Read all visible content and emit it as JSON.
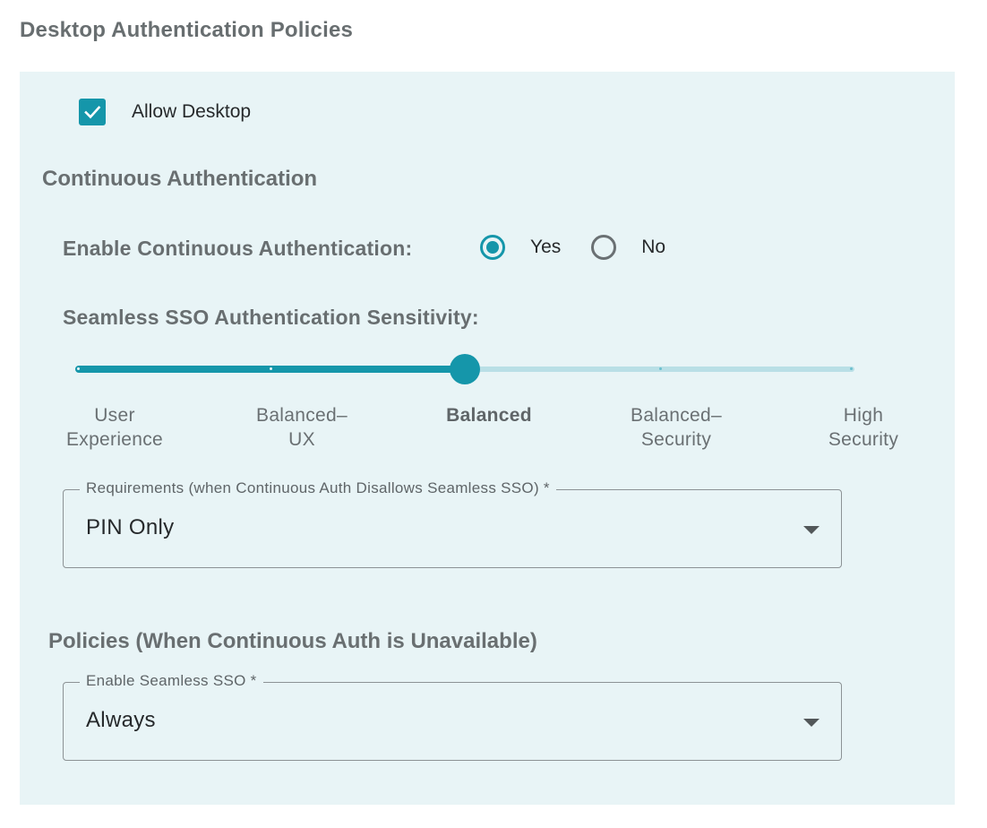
{
  "page": {
    "title": "Desktop Authentication Policies"
  },
  "allow_desktop": {
    "label": "Allow Desktop",
    "checked": true
  },
  "continuous_auth": {
    "section_title": "Continuous Authentication",
    "enable_label": "Enable Continuous Authentication:",
    "options": [
      {
        "label": "Yes",
        "selected": true
      },
      {
        "label": "No",
        "selected": false
      }
    ],
    "sensitivity": {
      "label": "Seamless SSO Authentication Sensitivity:",
      "marks": [
        {
          "line1": "User",
          "line2": "Experience"
        },
        {
          "line1": "Balanced–",
          "line2": "UX"
        },
        {
          "line1": "Balanced",
          "line2": ""
        },
        {
          "line1": "Balanced–",
          "line2": "Security"
        },
        {
          "line1": "High",
          "line2": "Security"
        }
      ],
      "selected_index": 2
    },
    "requirements": {
      "legend": "Requirements (when Continuous Auth Disallows Seamless SSO) *",
      "value": "PIN Only"
    }
  },
  "fallback_policies": {
    "section_title": "Policies (When Continuous Auth is Unavailable)",
    "seamless_sso": {
      "legend": "Enable Seamless SSO *",
      "value": "Always"
    }
  },
  "colors": {
    "accent": "#1596aa",
    "panel_background": "#e8f4f6",
    "rail": "#b9dfe6"
  }
}
